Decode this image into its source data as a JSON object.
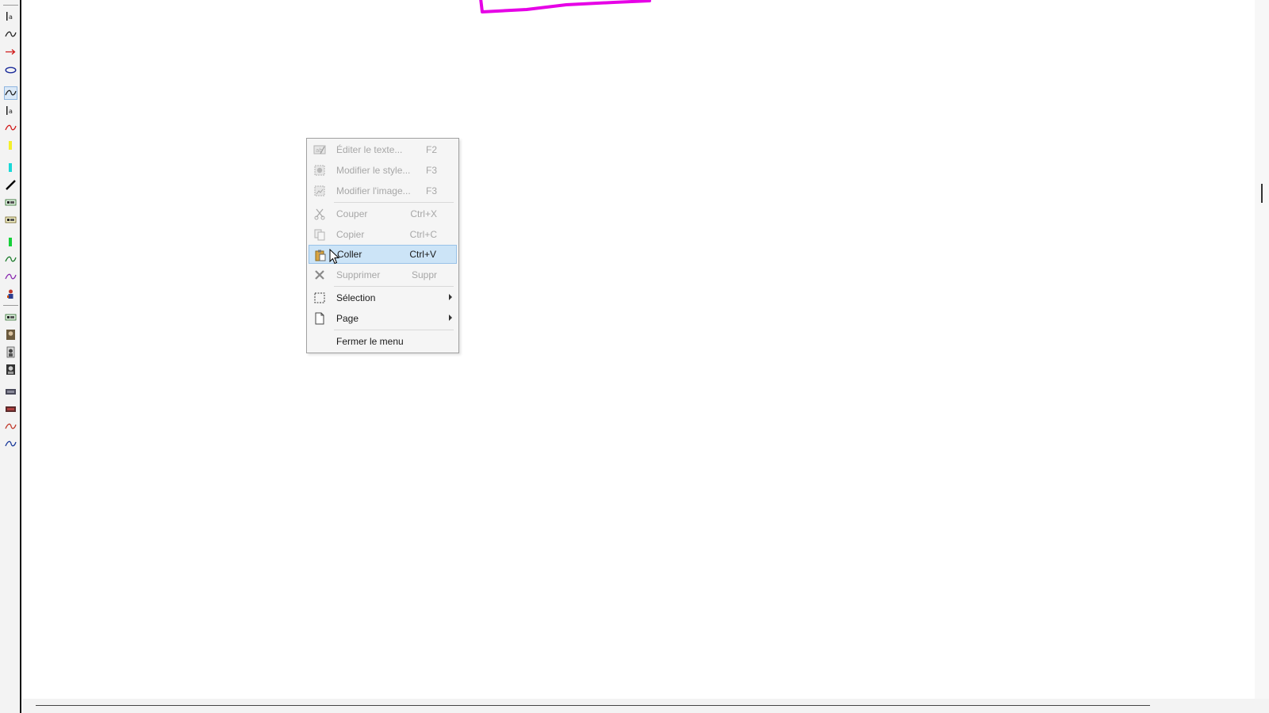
{
  "toolbar": {
    "tools": [
      {
        "icon": "text-tool-icon"
      },
      {
        "icon": "curve-black-icon"
      },
      {
        "icon": "arrow-red-icon"
      },
      {
        "icon": "ellipse-blue-icon"
      },
      {
        "icon": "freehand-icon",
        "active": true
      },
      {
        "icon": "text-tool-icon"
      },
      {
        "icon": "curve-red-icon"
      },
      {
        "icon": "highlighter-yellow-icon"
      },
      {
        "icon": "highlighter-cyan-icon"
      },
      {
        "icon": "pen-black-icon"
      },
      {
        "icon": "stamp-icon"
      },
      {
        "icon": "stamp-icon"
      },
      {
        "icon": "highlighter-green-icon"
      },
      {
        "icon": "curve-green-icon"
      },
      {
        "icon": "curve-purple-icon"
      },
      {
        "icon": "character-icon"
      },
      {
        "icon": "stamp-icon"
      },
      {
        "icon": "portrait-icon"
      },
      {
        "icon": "portrait-icon"
      },
      {
        "icon": "portrait-icon"
      },
      {
        "icon": "image-thumb-icon"
      },
      {
        "icon": "image-thumb-icon"
      },
      {
        "icon": "curve-red-icon"
      },
      {
        "icon": "curve-blue-icon"
      }
    ]
  },
  "canvas": {
    "shape_color": "#e600e6"
  },
  "context_menu": {
    "items": [
      {
        "label": "Éditer le texte...",
        "shortcut": "F2",
        "icon": "edit-text-icon",
        "disabled": true
      },
      {
        "label": "Modifier le style...",
        "shortcut": "F3",
        "icon": "style-icon",
        "disabled": true
      },
      {
        "label": "Modifier l'image...",
        "shortcut": "F3",
        "icon": "image-edit-icon",
        "disabled": true
      },
      {
        "label": "Couper",
        "shortcut": "Ctrl+X",
        "icon": "scissors-icon",
        "disabled": true
      },
      {
        "label": "Copier",
        "shortcut": "Ctrl+C",
        "icon": "copy-icon",
        "disabled": true
      },
      {
        "label": "Coller",
        "shortcut": "Ctrl+V",
        "icon": "paste-icon",
        "disabled": false,
        "highlighted": true
      },
      {
        "label": "Supprimer",
        "shortcut": "Suppr",
        "icon": "delete-icon",
        "disabled": true
      },
      {
        "label": "Sélection",
        "shortcut": "",
        "icon": "selection-icon",
        "submenu": true
      },
      {
        "label": "Page",
        "shortcut": "",
        "icon": "page-icon",
        "submenu": true
      },
      {
        "label": "Fermer le menu",
        "shortcut": "",
        "icon": "",
        "disabled": false
      }
    ]
  }
}
